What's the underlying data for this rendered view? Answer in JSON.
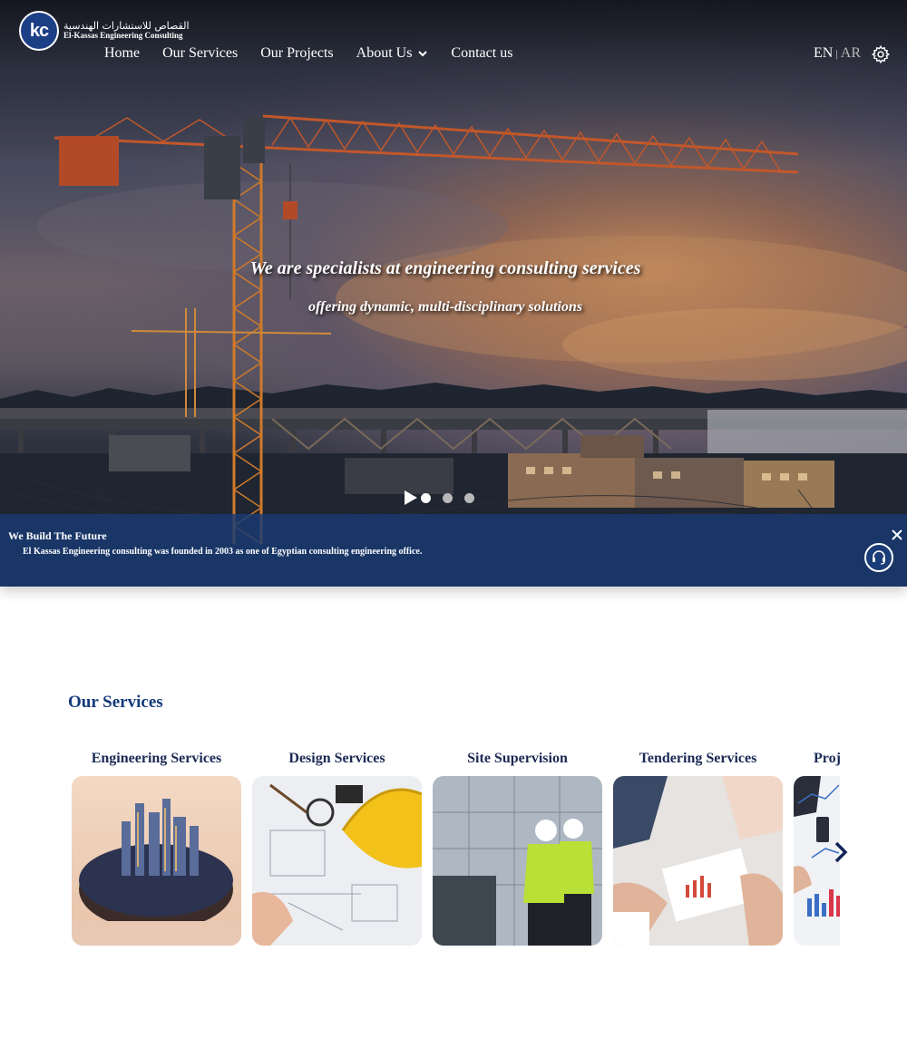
{
  "logo": {
    "mark": "kc",
    "arabic_name": "القصاص للاستشارات الهندسية",
    "english_name": "El-Kassas Engineering Consulting"
  },
  "nav": {
    "items": [
      "Home",
      "Our Services",
      "Our Projects",
      "About Us",
      "Contact us"
    ],
    "about_icon": "chevron-down-icon"
  },
  "language": {
    "en": "EN",
    "separator": "|",
    "ar": "AR",
    "settings_icon": "gear-icon"
  },
  "hero": {
    "headline": "We are specialists at engineering consulting services",
    "subline": "offering dynamic, multi-disciplinary solutions",
    "slider": {
      "play_icon": "play-icon",
      "slide_count": 3,
      "active_slide": 1
    }
  },
  "banner": {
    "title": "We Build The Future",
    "text": "El Kassas Engineering consulting was founded in 2003 as one of Egyptian consulting engineering office.",
    "close_icon": "close-icon",
    "support_icon": "headset-icon"
  },
  "services": {
    "title": "Our Services",
    "cards": [
      {
        "label": "Engineering Services"
      },
      {
        "label": "Design Services"
      },
      {
        "label": "Site Supervision"
      },
      {
        "label": "Tendering Services"
      },
      {
        "label": "Proj"
      }
    ],
    "next_icon": "chevron-right-icon"
  },
  "colors": {
    "brand_blue": "#123a7a",
    "banner_blue": "#183a74",
    "text_dark": "#1b2a55"
  }
}
